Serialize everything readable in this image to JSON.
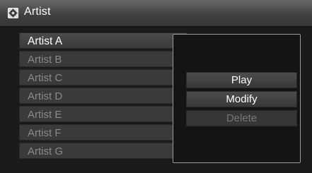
{
  "header": {
    "title": "Artist",
    "icon": "settings-icon"
  },
  "list": {
    "items": [
      {
        "label": "Artist A",
        "active": true
      },
      {
        "label": "Artist B",
        "active": false
      },
      {
        "label": "Artist C",
        "active": false
      },
      {
        "label": "Artist D",
        "active": false
      },
      {
        "label": "Artist E",
        "active": false
      },
      {
        "label": "Artist F",
        "active": false
      },
      {
        "label": "Artist G",
        "active": false
      }
    ]
  },
  "popup": {
    "buttons": [
      {
        "label": "Play",
        "enabled": true
      },
      {
        "label": "Modify",
        "enabled": true
      },
      {
        "label": "Delete",
        "enabled": false
      }
    ]
  }
}
